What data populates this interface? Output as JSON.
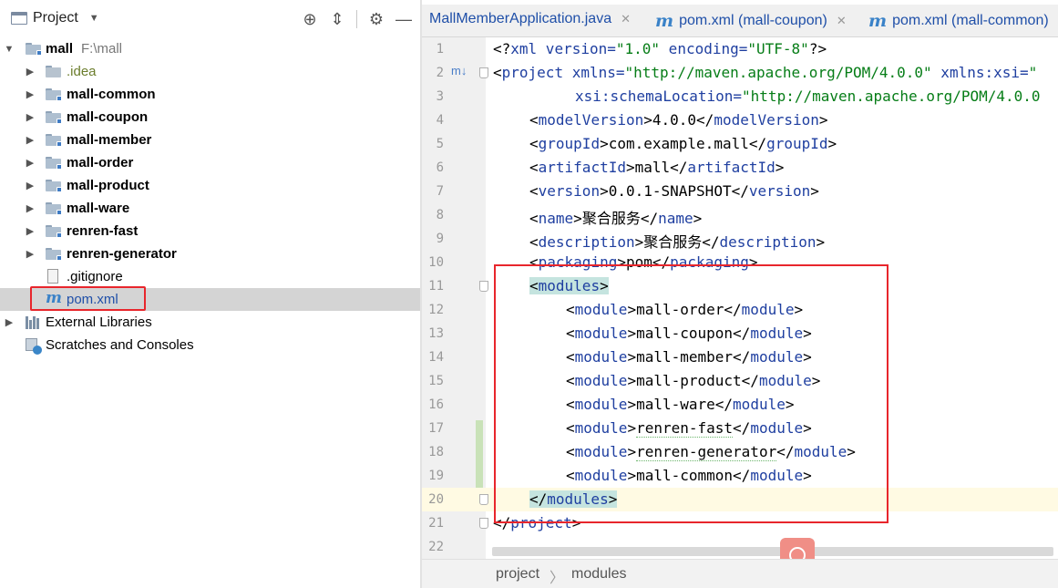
{
  "project_panel": {
    "title": "Project",
    "root": {
      "name": "mall",
      "path": "F:\\mall"
    },
    "items": [
      {
        "label": ".idea",
        "type": "folder"
      },
      {
        "label": "mall-common",
        "type": "module"
      },
      {
        "label": "mall-coupon",
        "type": "module"
      },
      {
        "label": "mall-member",
        "type": "module"
      },
      {
        "label": "mall-order",
        "type": "module"
      },
      {
        "label": "mall-product",
        "type": "module"
      },
      {
        "label": "mall-ware",
        "type": "module"
      },
      {
        "label": "renren-fast",
        "type": "module"
      },
      {
        "label": "renren-generator",
        "type": "module"
      },
      {
        "label": ".gitignore",
        "type": "file"
      },
      {
        "label": "pom.xml",
        "type": "maven",
        "selected": true
      }
    ],
    "external_libraries": "External Libraries",
    "scratches": "Scratches and Consoles"
  },
  "tabs": [
    {
      "label": "MallMemberApplication.java"
    },
    {
      "label": "pom.xml (mall-coupon)"
    },
    {
      "label": "pom.xml (mall-common)"
    }
  ],
  "editor": {
    "line_numbers": [
      "1",
      "2",
      "3",
      "4",
      "5",
      "6",
      "7",
      "8",
      "9",
      "10",
      "11",
      "12",
      "13",
      "14",
      "15",
      "16",
      "17",
      "18",
      "19",
      "20",
      "21",
      "22"
    ],
    "code": {
      "l1": {
        "a": "<?",
        "b": "xml",
        "c": " version=",
        "d": "\"1.0\"",
        "e": " encoding=",
        "f": "\"UTF-8\"",
        "g": "?>"
      },
      "l2": {
        "a": "<",
        "b": "project",
        "c": " xmlns=",
        "d": "\"http://maven.apache.org/POM/4.0.0\"",
        "e": " xmlns:xsi=",
        "f": "\""
      },
      "l3": {
        "a": "xsi:schemaLocation=",
        "b": "\"http://maven.apache.org/POM/4.0.0"
      },
      "l4": {
        "tag": "modelVersion",
        "text": "4.0.0"
      },
      "l5": {
        "tag": "groupId",
        "text": "com.example.mall"
      },
      "l6": {
        "tag": "artifactId",
        "text": "mall"
      },
      "l7": {
        "tag": "version",
        "text": "0.0.1-SNAPSHOT"
      },
      "l8": {
        "tag": "name",
        "text": "聚合服务"
      },
      "l9": {
        "tag": "description",
        "text": "聚合服务"
      },
      "l10": {
        "tag": "packaging",
        "text": "pom"
      },
      "l11": {
        "tag": "modules"
      },
      "modules": [
        "mall-order",
        "mall-coupon",
        "mall-member",
        "mall-product",
        "mall-ware",
        "renren-fast",
        "renren-generator",
        "mall-common"
      ],
      "module_tag": "module",
      "l20": {
        "tag": "modules"
      },
      "l21": {
        "tag": "project"
      }
    }
  },
  "breadcrumb": [
    "project",
    "modules"
  ],
  "colors": {
    "accent_red": "#e8262c",
    "tag_blue": "#1f3fa0",
    "string_green": "#067d17"
  }
}
